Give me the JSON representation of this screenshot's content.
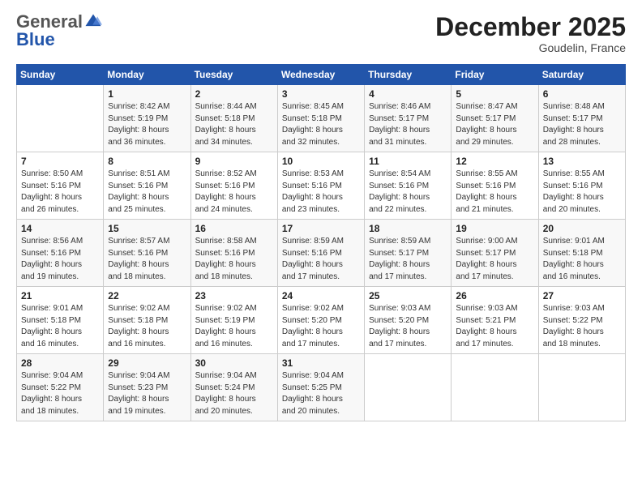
{
  "header": {
    "logo_general": "General",
    "logo_blue": "Blue",
    "month": "December 2025",
    "location": "Goudelin, France"
  },
  "days_of_week": [
    "Sunday",
    "Monday",
    "Tuesday",
    "Wednesday",
    "Thursday",
    "Friday",
    "Saturday"
  ],
  "weeks": [
    [
      {
        "num": "",
        "info": ""
      },
      {
        "num": "1",
        "info": "Sunrise: 8:42 AM\nSunset: 5:19 PM\nDaylight: 8 hours\nand 36 minutes."
      },
      {
        "num": "2",
        "info": "Sunrise: 8:44 AM\nSunset: 5:18 PM\nDaylight: 8 hours\nand 34 minutes."
      },
      {
        "num": "3",
        "info": "Sunrise: 8:45 AM\nSunset: 5:18 PM\nDaylight: 8 hours\nand 32 minutes."
      },
      {
        "num": "4",
        "info": "Sunrise: 8:46 AM\nSunset: 5:17 PM\nDaylight: 8 hours\nand 31 minutes."
      },
      {
        "num": "5",
        "info": "Sunrise: 8:47 AM\nSunset: 5:17 PM\nDaylight: 8 hours\nand 29 minutes."
      },
      {
        "num": "6",
        "info": "Sunrise: 8:48 AM\nSunset: 5:17 PM\nDaylight: 8 hours\nand 28 minutes."
      }
    ],
    [
      {
        "num": "7",
        "info": "Sunrise: 8:50 AM\nSunset: 5:16 PM\nDaylight: 8 hours\nand 26 minutes."
      },
      {
        "num": "8",
        "info": "Sunrise: 8:51 AM\nSunset: 5:16 PM\nDaylight: 8 hours\nand 25 minutes."
      },
      {
        "num": "9",
        "info": "Sunrise: 8:52 AM\nSunset: 5:16 PM\nDaylight: 8 hours\nand 24 minutes."
      },
      {
        "num": "10",
        "info": "Sunrise: 8:53 AM\nSunset: 5:16 PM\nDaylight: 8 hours\nand 23 minutes."
      },
      {
        "num": "11",
        "info": "Sunrise: 8:54 AM\nSunset: 5:16 PM\nDaylight: 8 hours\nand 22 minutes."
      },
      {
        "num": "12",
        "info": "Sunrise: 8:55 AM\nSunset: 5:16 PM\nDaylight: 8 hours\nand 21 minutes."
      },
      {
        "num": "13",
        "info": "Sunrise: 8:55 AM\nSunset: 5:16 PM\nDaylight: 8 hours\nand 20 minutes."
      }
    ],
    [
      {
        "num": "14",
        "info": "Sunrise: 8:56 AM\nSunset: 5:16 PM\nDaylight: 8 hours\nand 19 minutes."
      },
      {
        "num": "15",
        "info": "Sunrise: 8:57 AM\nSunset: 5:16 PM\nDaylight: 8 hours\nand 18 minutes."
      },
      {
        "num": "16",
        "info": "Sunrise: 8:58 AM\nSunset: 5:16 PM\nDaylight: 8 hours\nand 18 minutes."
      },
      {
        "num": "17",
        "info": "Sunrise: 8:59 AM\nSunset: 5:16 PM\nDaylight: 8 hours\nand 17 minutes."
      },
      {
        "num": "18",
        "info": "Sunrise: 8:59 AM\nSunset: 5:17 PM\nDaylight: 8 hours\nand 17 minutes."
      },
      {
        "num": "19",
        "info": "Sunrise: 9:00 AM\nSunset: 5:17 PM\nDaylight: 8 hours\nand 17 minutes."
      },
      {
        "num": "20",
        "info": "Sunrise: 9:01 AM\nSunset: 5:18 PM\nDaylight: 8 hours\nand 16 minutes."
      }
    ],
    [
      {
        "num": "21",
        "info": "Sunrise: 9:01 AM\nSunset: 5:18 PM\nDaylight: 8 hours\nand 16 minutes."
      },
      {
        "num": "22",
        "info": "Sunrise: 9:02 AM\nSunset: 5:18 PM\nDaylight: 8 hours\nand 16 minutes."
      },
      {
        "num": "23",
        "info": "Sunrise: 9:02 AM\nSunset: 5:19 PM\nDaylight: 8 hours\nand 16 minutes."
      },
      {
        "num": "24",
        "info": "Sunrise: 9:02 AM\nSunset: 5:20 PM\nDaylight: 8 hours\nand 17 minutes."
      },
      {
        "num": "25",
        "info": "Sunrise: 9:03 AM\nSunset: 5:20 PM\nDaylight: 8 hours\nand 17 minutes."
      },
      {
        "num": "26",
        "info": "Sunrise: 9:03 AM\nSunset: 5:21 PM\nDaylight: 8 hours\nand 17 minutes."
      },
      {
        "num": "27",
        "info": "Sunrise: 9:03 AM\nSunset: 5:22 PM\nDaylight: 8 hours\nand 18 minutes."
      }
    ],
    [
      {
        "num": "28",
        "info": "Sunrise: 9:04 AM\nSunset: 5:22 PM\nDaylight: 8 hours\nand 18 minutes."
      },
      {
        "num": "29",
        "info": "Sunrise: 9:04 AM\nSunset: 5:23 PM\nDaylight: 8 hours\nand 19 minutes."
      },
      {
        "num": "30",
        "info": "Sunrise: 9:04 AM\nSunset: 5:24 PM\nDaylight: 8 hours\nand 20 minutes."
      },
      {
        "num": "31",
        "info": "Sunrise: 9:04 AM\nSunset: 5:25 PM\nDaylight: 8 hours\nand 20 minutes."
      },
      {
        "num": "",
        "info": ""
      },
      {
        "num": "",
        "info": ""
      },
      {
        "num": "",
        "info": ""
      }
    ]
  ]
}
